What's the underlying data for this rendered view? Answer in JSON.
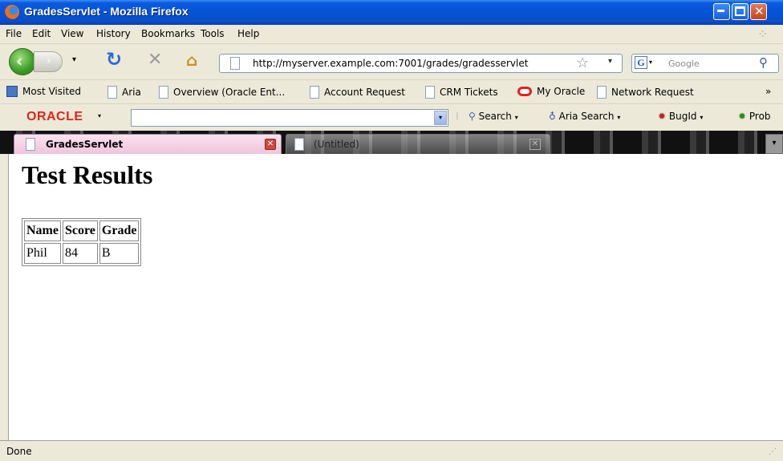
{
  "window": {
    "title": "GradesServlet - Mozilla Firefox"
  },
  "menu": {
    "items": [
      "File",
      "Edit",
      "View",
      "History",
      "Bookmarks",
      "Tools",
      "Help"
    ]
  },
  "nav": {
    "url": "http://myserver.example.com:7001/grades/gradesservlet",
    "search_placeholder": "Google",
    "search_engine_icon": "G"
  },
  "bookmarks": {
    "items": [
      {
        "label": "Most Visited",
        "icon": "most-visited-icon"
      },
      {
        "label": "Aria",
        "icon": "page-icon"
      },
      {
        "label": "Overview (Oracle Ent...",
        "icon": "page-icon"
      },
      {
        "label": "Account Request",
        "icon": "page-icon"
      },
      {
        "label": "CRM Tickets",
        "icon": "page-icon"
      },
      {
        "label": "My Oracle",
        "icon": "oracle-icon"
      },
      {
        "label": "Network Request",
        "icon": "page-icon"
      }
    ],
    "overflow": "»"
  },
  "oracle_toolbar": {
    "logo": "ORACLE",
    "search_label": "Search",
    "aria_search_label": "Aria Search",
    "bugid_label": "BugId",
    "prob_label": "Prob"
  },
  "tabs": [
    {
      "label": "GradesServlet",
      "active": true
    },
    {
      "label": "(Untitled)",
      "active": false
    }
  ],
  "page": {
    "heading": "Test Results",
    "table": {
      "headers": [
        "Name",
        "Score",
        "Grade"
      ],
      "rows": [
        [
          "Phil",
          "84",
          "B"
        ]
      ]
    }
  },
  "status": {
    "text": "Done"
  },
  "colors": {
    "titlebar": "#0553d6",
    "oracle_red": "#e2231a",
    "tab_active": "#fbe2f0"
  }
}
